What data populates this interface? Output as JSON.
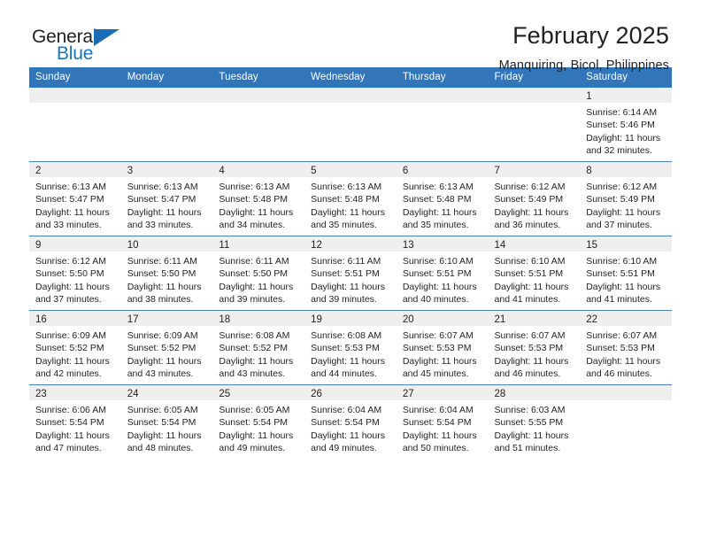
{
  "logo": {
    "word_top": "General",
    "word_bottom": "Blue",
    "top_color": "#231f20",
    "bottom_color": "#1b75bb",
    "triangle_color": "#1b6cb0"
  },
  "header": {
    "title": "February 2025",
    "subtitle": "Manquiring, Bicol, Philippines"
  },
  "theme": {
    "header_bg": "#3275b8",
    "daynum_bg": "#efefef",
    "row_border": "#4a7fb5",
    "text": "#231f20"
  },
  "weekdays": [
    "Sunday",
    "Monday",
    "Tuesday",
    "Wednesday",
    "Thursday",
    "Friday",
    "Saturday"
  ],
  "weeks": [
    [
      {
        "day": "",
        "sunrise": "",
        "sunset": "",
        "daylight": ""
      },
      {
        "day": "",
        "sunrise": "",
        "sunset": "",
        "daylight": ""
      },
      {
        "day": "",
        "sunrise": "",
        "sunset": "",
        "daylight": ""
      },
      {
        "day": "",
        "sunrise": "",
        "sunset": "",
        "daylight": ""
      },
      {
        "day": "",
        "sunrise": "",
        "sunset": "",
        "daylight": ""
      },
      {
        "day": "",
        "sunrise": "",
        "sunset": "",
        "daylight": ""
      },
      {
        "day": "1",
        "sunrise": "Sunrise: 6:14 AM",
        "sunset": "Sunset: 5:46 PM",
        "daylight": "Daylight: 11 hours and 32 minutes."
      }
    ],
    [
      {
        "day": "2",
        "sunrise": "Sunrise: 6:13 AM",
        "sunset": "Sunset: 5:47 PM",
        "daylight": "Daylight: 11 hours and 33 minutes."
      },
      {
        "day": "3",
        "sunrise": "Sunrise: 6:13 AM",
        "sunset": "Sunset: 5:47 PM",
        "daylight": "Daylight: 11 hours and 33 minutes."
      },
      {
        "day": "4",
        "sunrise": "Sunrise: 6:13 AM",
        "sunset": "Sunset: 5:48 PM",
        "daylight": "Daylight: 11 hours and 34 minutes."
      },
      {
        "day": "5",
        "sunrise": "Sunrise: 6:13 AM",
        "sunset": "Sunset: 5:48 PM",
        "daylight": "Daylight: 11 hours and 35 minutes."
      },
      {
        "day": "6",
        "sunrise": "Sunrise: 6:13 AM",
        "sunset": "Sunset: 5:48 PM",
        "daylight": "Daylight: 11 hours and 35 minutes."
      },
      {
        "day": "7",
        "sunrise": "Sunrise: 6:12 AM",
        "sunset": "Sunset: 5:49 PM",
        "daylight": "Daylight: 11 hours and 36 minutes."
      },
      {
        "day": "8",
        "sunrise": "Sunrise: 6:12 AM",
        "sunset": "Sunset: 5:49 PM",
        "daylight": "Daylight: 11 hours and 37 minutes."
      }
    ],
    [
      {
        "day": "9",
        "sunrise": "Sunrise: 6:12 AM",
        "sunset": "Sunset: 5:50 PM",
        "daylight": "Daylight: 11 hours and 37 minutes."
      },
      {
        "day": "10",
        "sunrise": "Sunrise: 6:11 AM",
        "sunset": "Sunset: 5:50 PM",
        "daylight": "Daylight: 11 hours and 38 minutes."
      },
      {
        "day": "11",
        "sunrise": "Sunrise: 6:11 AM",
        "sunset": "Sunset: 5:50 PM",
        "daylight": "Daylight: 11 hours and 39 minutes."
      },
      {
        "day": "12",
        "sunrise": "Sunrise: 6:11 AM",
        "sunset": "Sunset: 5:51 PM",
        "daylight": "Daylight: 11 hours and 39 minutes."
      },
      {
        "day": "13",
        "sunrise": "Sunrise: 6:10 AM",
        "sunset": "Sunset: 5:51 PM",
        "daylight": "Daylight: 11 hours and 40 minutes."
      },
      {
        "day": "14",
        "sunrise": "Sunrise: 6:10 AM",
        "sunset": "Sunset: 5:51 PM",
        "daylight": "Daylight: 11 hours and 41 minutes."
      },
      {
        "day": "15",
        "sunrise": "Sunrise: 6:10 AM",
        "sunset": "Sunset: 5:51 PM",
        "daylight": "Daylight: 11 hours and 41 minutes."
      }
    ],
    [
      {
        "day": "16",
        "sunrise": "Sunrise: 6:09 AM",
        "sunset": "Sunset: 5:52 PM",
        "daylight": "Daylight: 11 hours and 42 minutes."
      },
      {
        "day": "17",
        "sunrise": "Sunrise: 6:09 AM",
        "sunset": "Sunset: 5:52 PM",
        "daylight": "Daylight: 11 hours and 43 minutes."
      },
      {
        "day": "18",
        "sunrise": "Sunrise: 6:08 AM",
        "sunset": "Sunset: 5:52 PM",
        "daylight": "Daylight: 11 hours and 43 minutes."
      },
      {
        "day": "19",
        "sunrise": "Sunrise: 6:08 AM",
        "sunset": "Sunset: 5:53 PM",
        "daylight": "Daylight: 11 hours and 44 minutes."
      },
      {
        "day": "20",
        "sunrise": "Sunrise: 6:07 AM",
        "sunset": "Sunset: 5:53 PM",
        "daylight": "Daylight: 11 hours and 45 minutes."
      },
      {
        "day": "21",
        "sunrise": "Sunrise: 6:07 AM",
        "sunset": "Sunset: 5:53 PM",
        "daylight": "Daylight: 11 hours and 46 minutes."
      },
      {
        "day": "22",
        "sunrise": "Sunrise: 6:07 AM",
        "sunset": "Sunset: 5:53 PM",
        "daylight": "Daylight: 11 hours and 46 minutes."
      }
    ],
    [
      {
        "day": "23",
        "sunrise": "Sunrise: 6:06 AM",
        "sunset": "Sunset: 5:54 PM",
        "daylight": "Daylight: 11 hours and 47 minutes."
      },
      {
        "day": "24",
        "sunrise": "Sunrise: 6:05 AM",
        "sunset": "Sunset: 5:54 PM",
        "daylight": "Daylight: 11 hours and 48 minutes."
      },
      {
        "day": "25",
        "sunrise": "Sunrise: 6:05 AM",
        "sunset": "Sunset: 5:54 PM",
        "daylight": "Daylight: 11 hours and 49 minutes."
      },
      {
        "day": "26",
        "sunrise": "Sunrise: 6:04 AM",
        "sunset": "Sunset: 5:54 PM",
        "daylight": "Daylight: 11 hours and 49 minutes."
      },
      {
        "day": "27",
        "sunrise": "Sunrise: 6:04 AM",
        "sunset": "Sunset: 5:54 PM",
        "daylight": "Daylight: 11 hours and 50 minutes."
      },
      {
        "day": "28",
        "sunrise": "Sunrise: 6:03 AM",
        "sunset": "Sunset: 5:55 PM",
        "daylight": "Daylight: 11 hours and 51 minutes."
      },
      {
        "day": "",
        "sunrise": "",
        "sunset": "",
        "daylight": ""
      }
    ]
  ]
}
